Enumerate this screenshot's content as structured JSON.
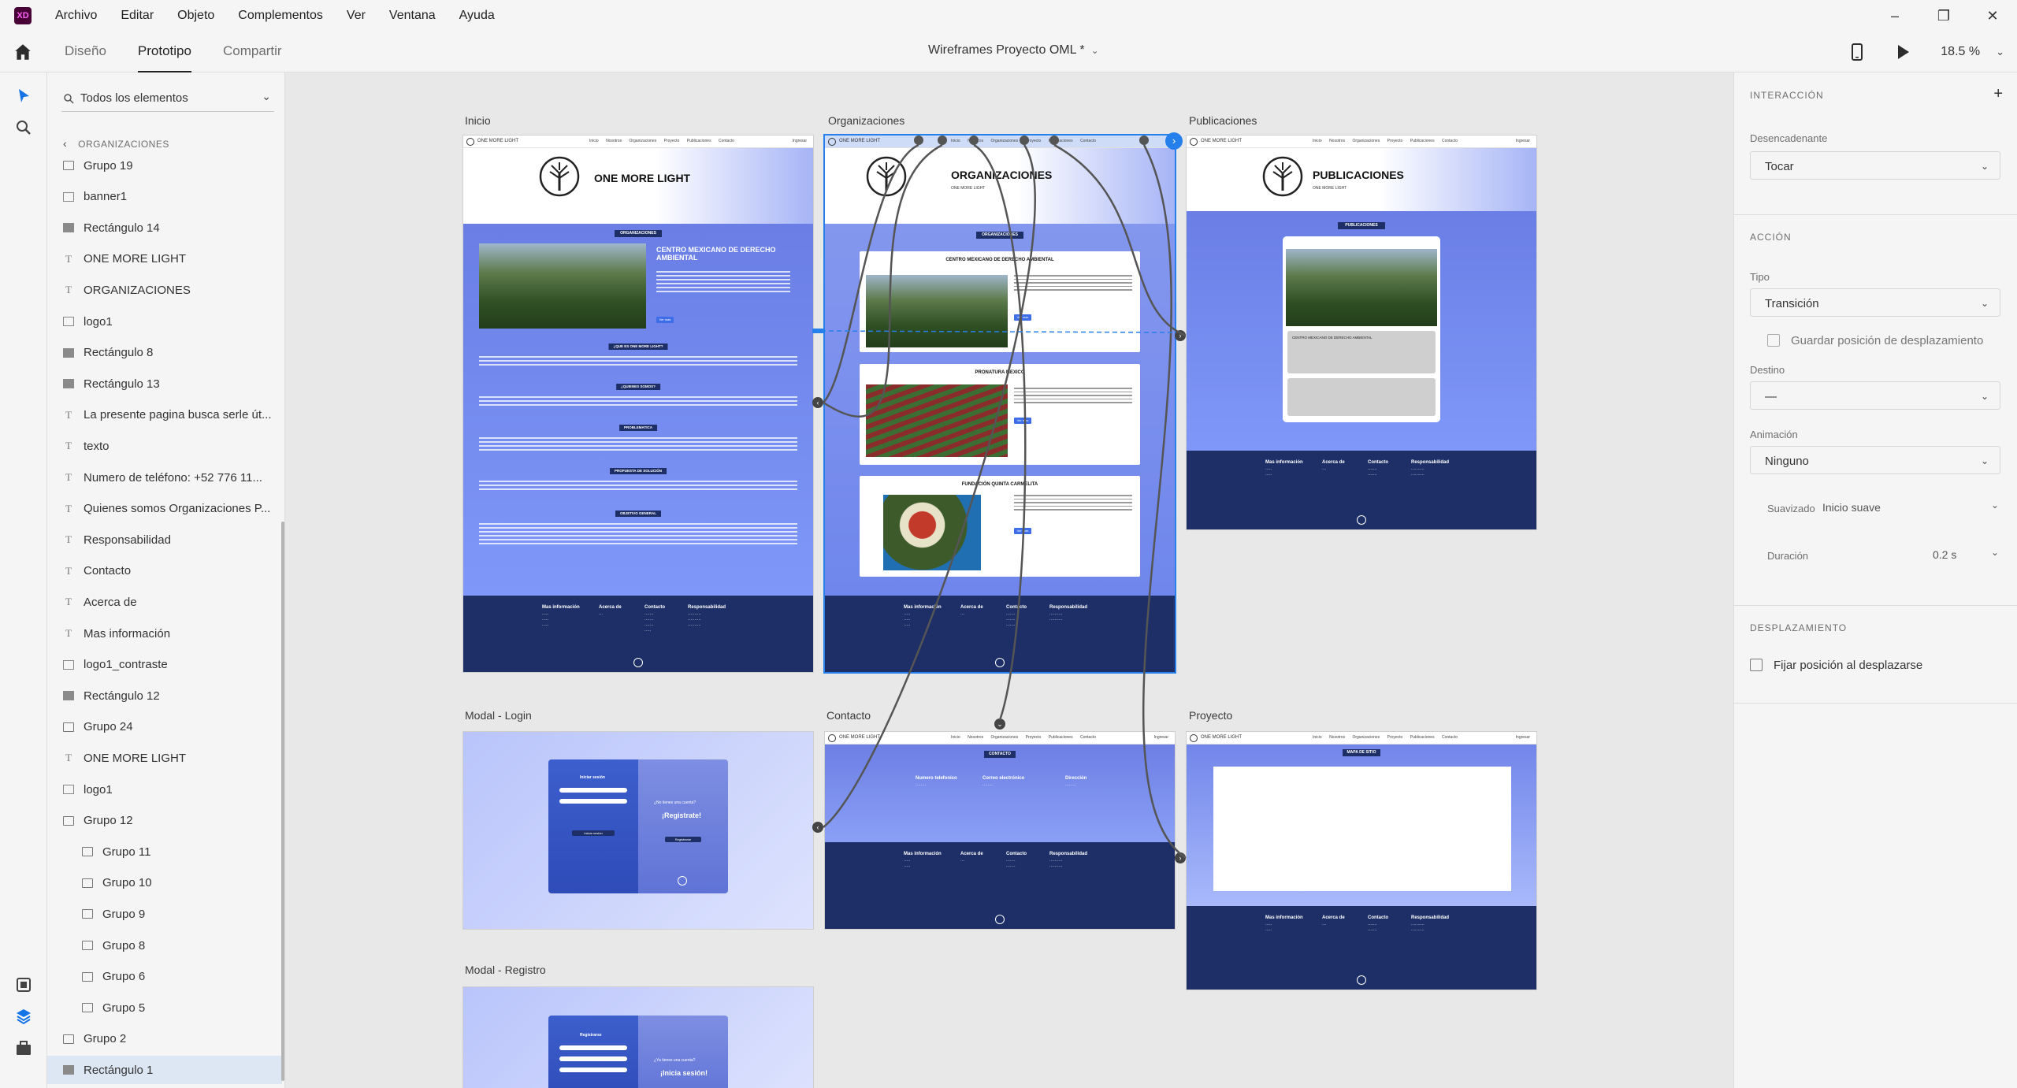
{
  "titlebar": {
    "app_icon": "XD",
    "menu": [
      "Archivo",
      "Editar",
      "Objeto",
      "Complementos",
      "Ver",
      "Ventana",
      "Ayuda"
    ]
  },
  "modebar": {
    "tabs": [
      "Diseño",
      "Prototipo",
      "Compartir"
    ],
    "active_tab": "Prototipo",
    "document_title": "Wireframes Proyecto OML *",
    "zoom": "18.5 %"
  },
  "layers": {
    "search_label": "Todos los elementos",
    "breadcrumb": "ORGANIZACIONES",
    "items": [
      {
        "label": "Grupo 19",
        "type": "folder"
      },
      {
        "label": "banner1",
        "type": "image"
      },
      {
        "label": "Rectángulo 14",
        "type": "rect"
      },
      {
        "label": "ONE MORE LIGHT",
        "type": "text"
      },
      {
        "label": "ORGANIZACIONES",
        "type": "text"
      },
      {
        "label": "logo1",
        "type": "image"
      },
      {
        "label": "Rectángulo 8",
        "type": "rect"
      },
      {
        "label": "Rectángulo 13",
        "type": "rect"
      },
      {
        "label": "La presente pagina busca serle út...",
        "type": "text"
      },
      {
        "label": "texto",
        "type": "text"
      },
      {
        "label": "Numero de teléfono: +52 776 11...",
        "type": "text"
      },
      {
        "label": "Quienes somos Organizaciones P...",
        "type": "text"
      },
      {
        "label": "Responsabilidad",
        "type": "text"
      },
      {
        "label": "Contacto",
        "type": "text"
      },
      {
        "label": "Acerca de",
        "type": "text"
      },
      {
        "label": "Mas información",
        "type": "text"
      },
      {
        "label": "logo1_contraste",
        "type": "image"
      },
      {
        "label": "Rectángulo 12",
        "type": "rect"
      },
      {
        "label": "Grupo 24",
        "type": "folder"
      },
      {
        "label": "ONE MORE LIGHT",
        "type": "text"
      },
      {
        "label": "logo1",
        "type": "image"
      },
      {
        "label": "Grupo 12",
        "type": "folder"
      },
      {
        "label": "Grupo 11",
        "type": "folder",
        "indent": true
      },
      {
        "label": "Grupo 10",
        "type": "folder",
        "indent": true
      },
      {
        "label": "Grupo 9",
        "type": "folder",
        "indent": true
      },
      {
        "label": "Grupo 8",
        "type": "folder",
        "indent": true
      },
      {
        "label": "Grupo 6",
        "type": "folder",
        "indent": true
      },
      {
        "label": "Grupo 5",
        "type": "folder",
        "indent": true
      },
      {
        "label": "Grupo 2",
        "type": "folder"
      },
      {
        "label": "Rectángulo 1",
        "type": "rect",
        "selected": true
      }
    ]
  },
  "canvas": {
    "artboards": {
      "inicio": "Inicio",
      "organizaciones": "Organizaciones",
      "publicaciones": "Publicaciones",
      "modal_login": "Modal - Login",
      "contacto": "Contacto",
      "proyecto": "Proyecto",
      "modal_registro": "Modal - Registro"
    },
    "site": {
      "brand": "ONE MORE LIGHT",
      "nav_links": [
        "Inicio",
        "Nosotros",
        "Organizaciones",
        "Proyecto",
        "Publicaciones",
        "Contacto"
      ],
      "nav_button": "Ingresar",
      "hero_inicio": "ONE MORE LIGHT",
      "hero_org": "ORGANIZACIONES",
      "hero_pub": "PUBLICACIONES",
      "hero_sub": "ONE MORE LIGHT",
      "chip_org": "ORGANIZACIONES",
      "chip_pub": "PUBLICACIONES",
      "chip_contacto": "CONTACTO",
      "chip_proyecto": "MAPA DE SITIO",
      "featured_org": "CENTRO MEXICANO DE DERECHO AMBIENTAL",
      "sections": [
        "¿QUE ES ONE MORE LIGHT?",
        "¿QUIENES SOMOS?",
        "PROBLEMATICA",
        "PROPUESTA DE SOLUCIÓN",
        "OBJETIVO GENERAL"
      ],
      "cards": [
        "CENTRO MEXICANO DE DERECHO AMBIENTAL",
        "PRONATURA MEXICO",
        "FUNDACIÓN QUINTA CARMELITA"
      ],
      "button_ver": "Ver mas",
      "pub_card_title": "CENTRO MEXICANO DE DERECHO AMBIENTAL",
      "footer_cols": [
        "Mas información",
        "Acerca de",
        "Contacto",
        "Responsabilidad"
      ],
      "contact_cols": [
        "Numero telefonico",
        "Correo electrónico",
        "Dirección"
      ],
      "login_title": "Iniciar sesión",
      "login_question": "¿No tienes una cuenta?",
      "login_cta": "¡Registrate!",
      "login_btn": "Iniciar sesión",
      "login_register_btn": "Registrarse",
      "registro_title": "Registrarse",
      "registro_question": "¿Ya tienes una cuenta?",
      "registro_cta": "¡Inicia sesión!"
    }
  },
  "props": {
    "section_interaction": "INTERACCIÓN",
    "trigger_label": "Desencadenante",
    "trigger_value": "Tocar",
    "section_action": "ACCIÓN",
    "type_label": "Tipo",
    "type_value": "Transición",
    "preserve_scroll": "Guardar posición de desplazamiento",
    "destination_label": "Destino",
    "destination_value": "—",
    "animation_label": "Animación",
    "animation_value": "Ninguno",
    "easing_label": "Suavizado",
    "easing_value": "Inicio suave",
    "duration_label": "Duración",
    "duration_value": "0.2 s",
    "section_scroll": "DESPLAZAMIENTO",
    "fix_position": "Fijar posición al desplazarse"
  },
  "colors": {
    "accent": "#2680eb",
    "site_blue": "#1d2f66",
    "gradient_blue": "#7f98f8"
  }
}
